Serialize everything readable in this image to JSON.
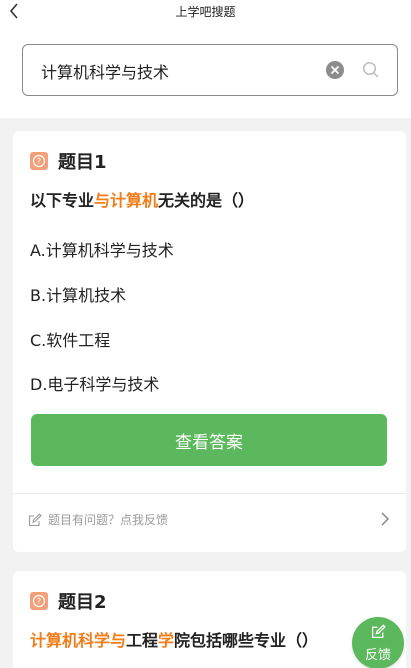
{
  "header": {
    "title": "上学吧搜题"
  },
  "search": {
    "query": "计算机科学与技术"
  },
  "questions": [
    {
      "label": "题目1",
      "text_parts": [
        "以下专业",
        "与计算机",
        "无关的是（）"
      ],
      "options": [
        "A.计算机科学与技术",
        "B.计算机技术",
        "C.软件工程",
        "D.电子科学与技术"
      ],
      "answer_button": "查看答案",
      "report_text": "题目有问题？点我反馈"
    },
    {
      "label": "题目2",
      "text_parts": [
        "计算机科学与",
        "工程",
        "学",
        "院包括哪些专业（）"
      ]
    }
  ],
  "feedback_fab": {
    "label": "反馈"
  },
  "colors": {
    "accent": "#5cb85c",
    "highlight": "#f07d1a",
    "icon": "#f3a07a"
  }
}
